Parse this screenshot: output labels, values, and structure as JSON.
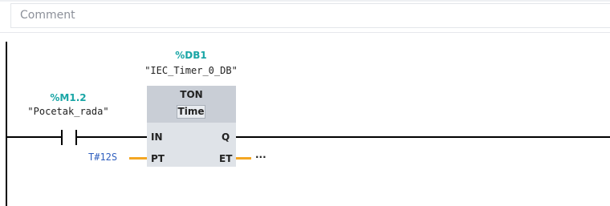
{
  "comment": {
    "placeholder": "Comment"
  },
  "contact": {
    "address": "%M1.2",
    "name": "\"Pocetak_rada\""
  },
  "instance": {
    "address": "%DB1",
    "name": "\"IEC_Timer_0_DB\""
  },
  "block": {
    "type": "TON",
    "time_type": "Time",
    "pins": {
      "in": "IN",
      "pt": "PT",
      "q": "Q",
      "et": "ET"
    }
  },
  "params": {
    "pt_value": "T#12S",
    "et_value": "..."
  },
  "colors": {
    "address": "#1aa6a6",
    "param_wire": "#f4a623",
    "constant": "#2f5fbf",
    "block": "#dfe3e8"
  }
}
